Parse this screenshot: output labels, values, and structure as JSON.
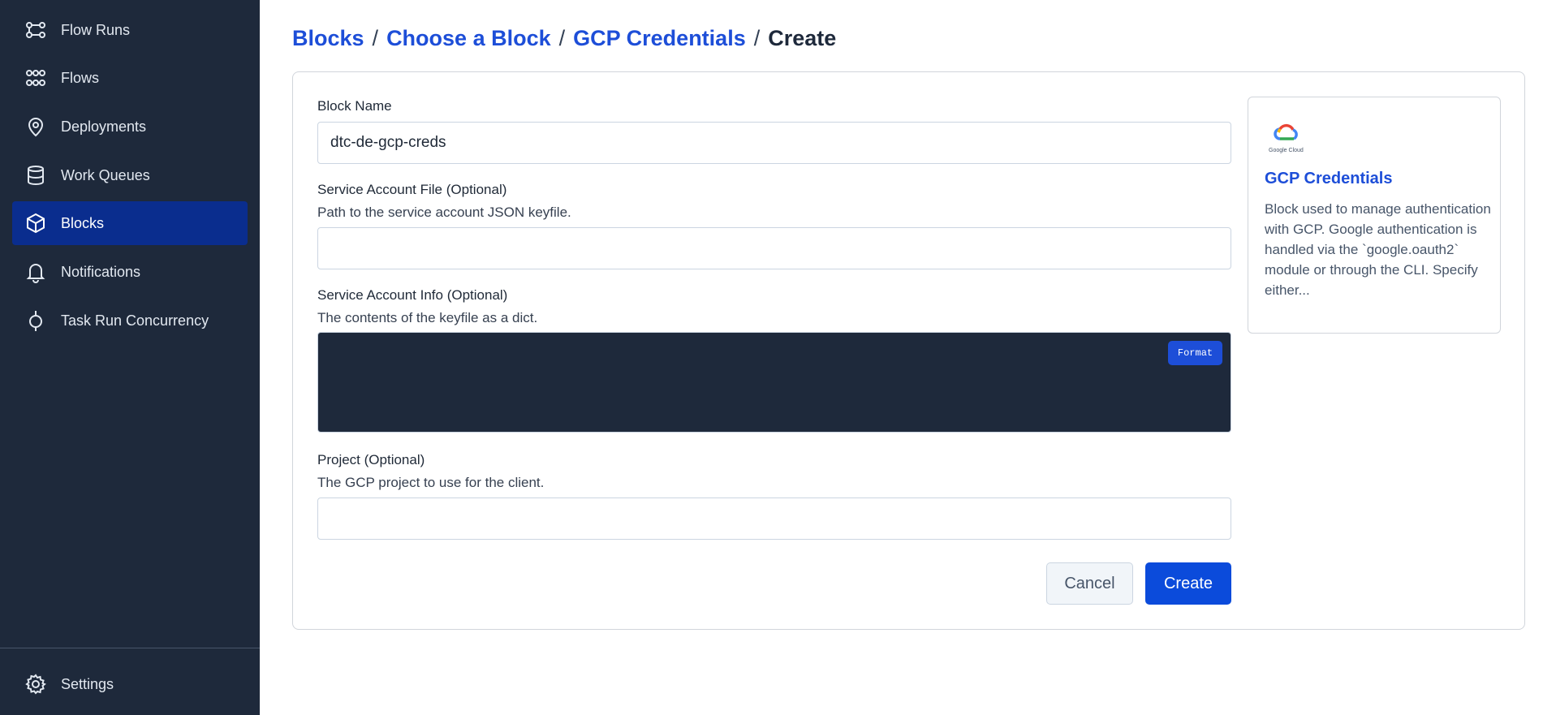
{
  "sidebar": {
    "items": [
      {
        "label": "Flow Runs",
        "icon": "flow-runs-icon"
      },
      {
        "label": "Flows",
        "icon": "flows-icon"
      },
      {
        "label": "Deployments",
        "icon": "location-pin-icon"
      },
      {
        "label": "Work Queues",
        "icon": "database-icon"
      },
      {
        "label": "Blocks",
        "icon": "cube-icon",
        "active": true
      },
      {
        "label": "Notifications",
        "icon": "bell-icon"
      },
      {
        "label": "Task Run Concurrency",
        "icon": "concurrency-icon"
      }
    ],
    "settings_label": "Settings"
  },
  "breadcrumb": {
    "items": [
      "Blocks",
      "Choose a Block",
      "GCP Credentials"
    ],
    "separator": "/",
    "current": "Create"
  },
  "form": {
    "block_name": {
      "label": "Block Name",
      "value": "dtc-de-gcp-creds"
    },
    "service_account_file": {
      "label": "Service Account File (Optional)",
      "description": "Path to the service account JSON keyfile.",
      "value": ""
    },
    "service_account_info": {
      "label": "Service Account Info (Optional)",
      "description": "The contents of the keyfile as a dict.",
      "format_label": "Format"
    },
    "project": {
      "label": "Project (Optional)",
      "description": "The GCP project to use for the client.",
      "value": ""
    },
    "cancel_label": "Cancel",
    "create_label": "Create"
  },
  "block_card": {
    "logo_caption": "Google Cloud",
    "title": "GCP Credentials",
    "description": "Block used to manage authentication with GCP. Google authentication is handled via the `google.oauth2` module or through the CLI. Specify either..."
  },
  "colors": {
    "sidebar_bg": "#1e293b",
    "active_item_bg": "#0a2d8e",
    "link_blue": "#1d4ed8",
    "primary_button": "#0b4bdb"
  }
}
